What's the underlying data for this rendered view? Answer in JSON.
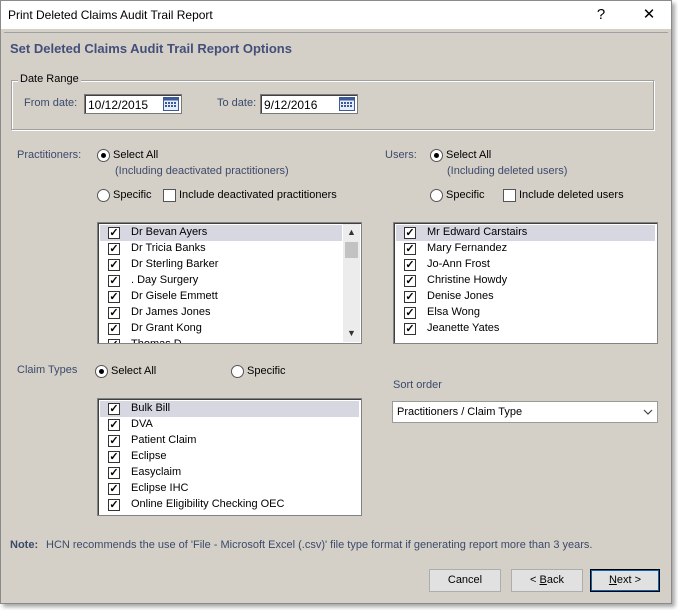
{
  "window": {
    "title": "Print Deleted Claims Audit Trail Report",
    "help": "?",
    "close": "✕"
  },
  "header": "Set Deleted Claims Audit Trail Report Options",
  "date_range": {
    "legend": "Date Range",
    "from_label": "From date:",
    "from_value": "10/12/2015",
    "to_label": "To date:",
    "to_value": "9/12/2016"
  },
  "practitioners": {
    "label": "Practitioners:",
    "select_all": "Select All",
    "select_all_hint": "(Including deactivated practitioners)",
    "specific": "Specific",
    "include_label": "Include deactivated practitioners",
    "items": [
      {
        "name": "Dr Bevan Ayers",
        "checked": true,
        "selected": true
      },
      {
        "name": "Dr Tricia Banks",
        "checked": true
      },
      {
        "name": "Dr Sterling Barker",
        "checked": true
      },
      {
        "name": ". Day Surgery",
        "checked": true
      },
      {
        "name": "Dr Gisele Emmett",
        "checked": true
      },
      {
        "name": "Dr James Jones",
        "checked": true
      },
      {
        "name": "Dr Grant Kong",
        "checked": true
      },
      {
        "name": "Thomas D",
        "checked": true
      }
    ]
  },
  "users": {
    "label": "Users:",
    "select_all": "Select All",
    "select_all_hint": "(Including deleted users)",
    "specific": "Specific",
    "include_label": "Include deleted users",
    "items": [
      {
        "name": "Mr Edward Carstairs",
        "checked": true,
        "selected": true
      },
      {
        "name": "Mary Fernandez",
        "checked": true
      },
      {
        "name": "Jo-Ann Frost",
        "checked": true
      },
      {
        "name": "Christine Howdy",
        "checked": true
      },
      {
        "name": "Denise Jones",
        "checked": true
      },
      {
        "name": "Elsa Wong",
        "checked": true
      },
      {
        "name": "Jeanette Yates",
        "checked": true
      }
    ]
  },
  "claim_types": {
    "label": "Claim Types",
    "select_all": "Select All",
    "specific": "Specific",
    "items": [
      {
        "name": "Bulk Bill",
        "checked": true,
        "selected": true
      },
      {
        "name": "DVA",
        "checked": true
      },
      {
        "name": "Patient Claim",
        "checked": true
      },
      {
        "name": "Eclipse",
        "checked": true
      },
      {
        "name": "Easyclaim",
        "checked": true
      },
      {
        "name": "Eclipse IHC",
        "checked": true
      },
      {
        "name": "Online Eligibility Checking OEC",
        "checked": true
      }
    ]
  },
  "sort_order": {
    "label": "Sort order",
    "value": "Practitioners / Claim Type"
  },
  "note": {
    "label": "Note:",
    "text": "HCN recommends the use of 'File - Microsoft Excel (.csv)' file type format if generating report more than 3 years."
  },
  "buttons": {
    "cancel": "Cancel",
    "back_prefix": "< ",
    "back_key": "B",
    "back_rest": "ack",
    "next_key": "N",
    "next_rest": "ext",
    "next_suffix": " >"
  },
  "icons": {
    "help": "question-icon",
    "close": "close-icon",
    "calendar": "calendar-icon",
    "check": "checkmark-icon",
    "scroll_up": "scroll-up-icon",
    "scroll_down": "scroll-down-icon",
    "dropdown": "chevron-down-icon"
  },
  "colors": {
    "dialog_bg": "#d4d0c8",
    "header_text": "#434f7a",
    "selection": "#d7d7e2"
  }
}
